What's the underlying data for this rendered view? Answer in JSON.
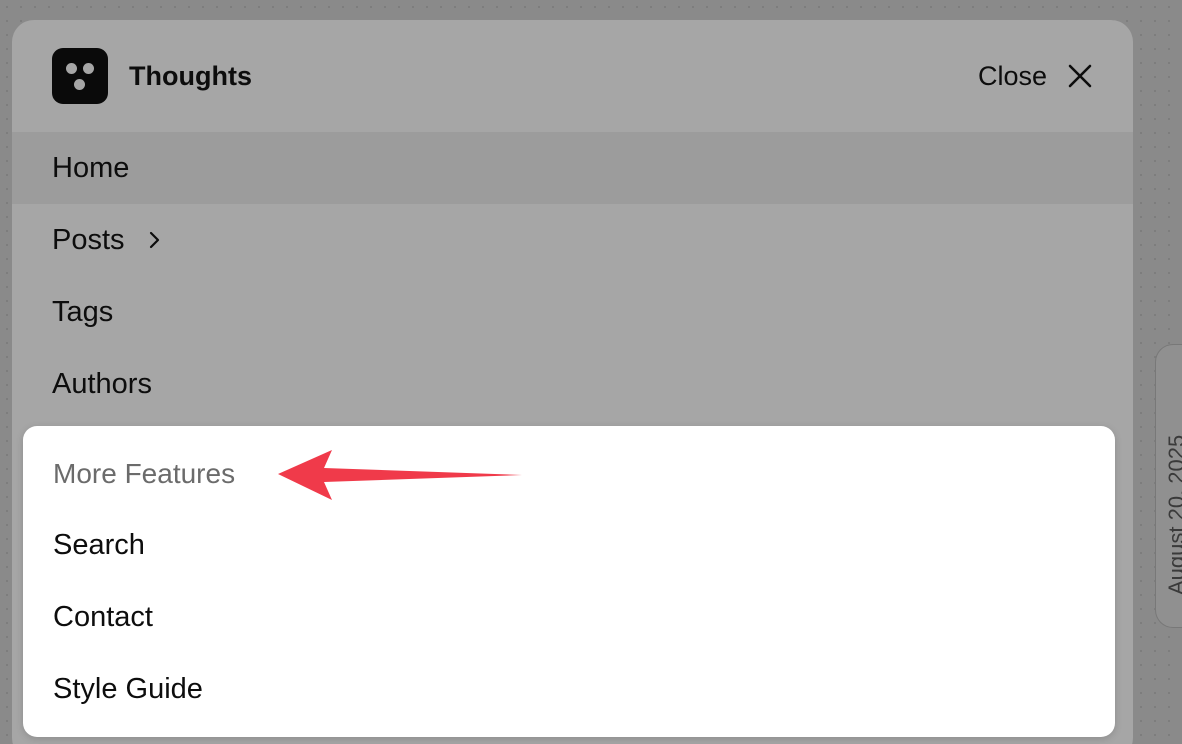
{
  "app": {
    "brand": "Thoughts"
  },
  "header": {
    "close_label": "Close"
  },
  "nav": {
    "items": [
      {
        "label": "Home",
        "active": true
      },
      {
        "label": "Posts",
        "has_submenu": true
      },
      {
        "label": "Tags"
      },
      {
        "label": "Authors"
      }
    ]
  },
  "more_features": {
    "heading": "More Features",
    "items": [
      {
        "label": "Search"
      },
      {
        "label": "Contact"
      },
      {
        "label": "Style Guide"
      }
    ]
  },
  "background_card": {
    "date": "August 20, 2025"
  },
  "icons": {
    "logo": "three-dots-logo-icon",
    "close": "close-icon",
    "submenu": "chevron-right-icon",
    "annotation": "red-arrow-icon"
  },
  "colors": {
    "annotation_arrow": "#f03a4a",
    "logo_bg": "#0a0a0a",
    "overlay_panel": "#a6a6a6",
    "features_card": "#ffffff",
    "muted_heading": "#6b6b6b"
  }
}
